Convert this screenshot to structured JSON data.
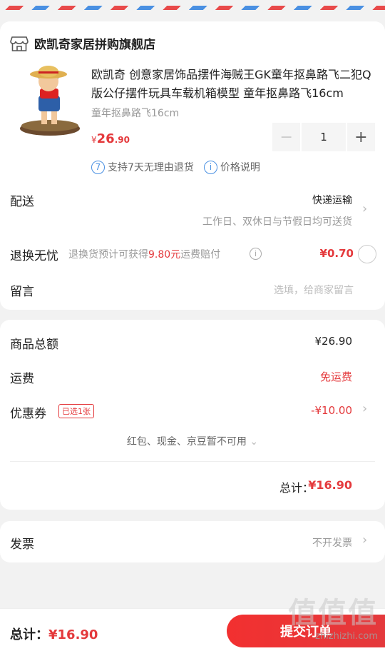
{
  "store": {
    "name": "欧凯奇家居拼购旗舰店",
    "icon": "store-icon"
  },
  "product": {
    "title": "欧凯奇 创意家居饰品摆件海贼王GK童年抠鼻路飞二犯Q版公仔摆件玩具车载机箱模型 童年抠鼻路飞16cm",
    "spec": "童年抠鼻路飞16cm",
    "price_symbol": "¥",
    "price_int": "26",
    "price_dec": ".90",
    "quantity": "1",
    "services": [
      {
        "icon": "7",
        "label": "支持7天无理由退货"
      },
      {
        "icon": "i",
        "label": "价格说明"
      }
    ]
  },
  "delivery": {
    "label": "配送",
    "method": "快递运输",
    "note": "工作日、双休日与节假日均可送货"
  },
  "return_insurance": {
    "label": "退换无忧",
    "note_pre": "退换货预计可获得",
    "note_amount": "9.80元",
    "note_post": "运费赔付",
    "price": "¥0.70"
  },
  "message": {
    "label": "留言",
    "placeholder": "选填，给商家留言"
  },
  "summary": {
    "goods_total_label": "商品总额",
    "goods_total": "¥26.90",
    "shipping_label": "运费",
    "shipping": "免运费",
    "coupon_label": "优惠券",
    "coupon_badge": "已选1张",
    "coupon_value": "-¥10.00",
    "unavailable": "红包、现金、京豆暂不可用",
    "total_label": "总计：",
    "total": "¥16.90"
  },
  "invoice": {
    "label": "发票",
    "value": "不开发票"
  },
  "bottom": {
    "total_label": "总计：",
    "total": "¥16.90",
    "submit": "提交订单"
  },
  "watermark": {
    "text": "值值值",
    "url": "zhizhizhi.com"
  },
  "colors": {
    "accent": "#e4393c",
    "info": "#4a90e2"
  }
}
